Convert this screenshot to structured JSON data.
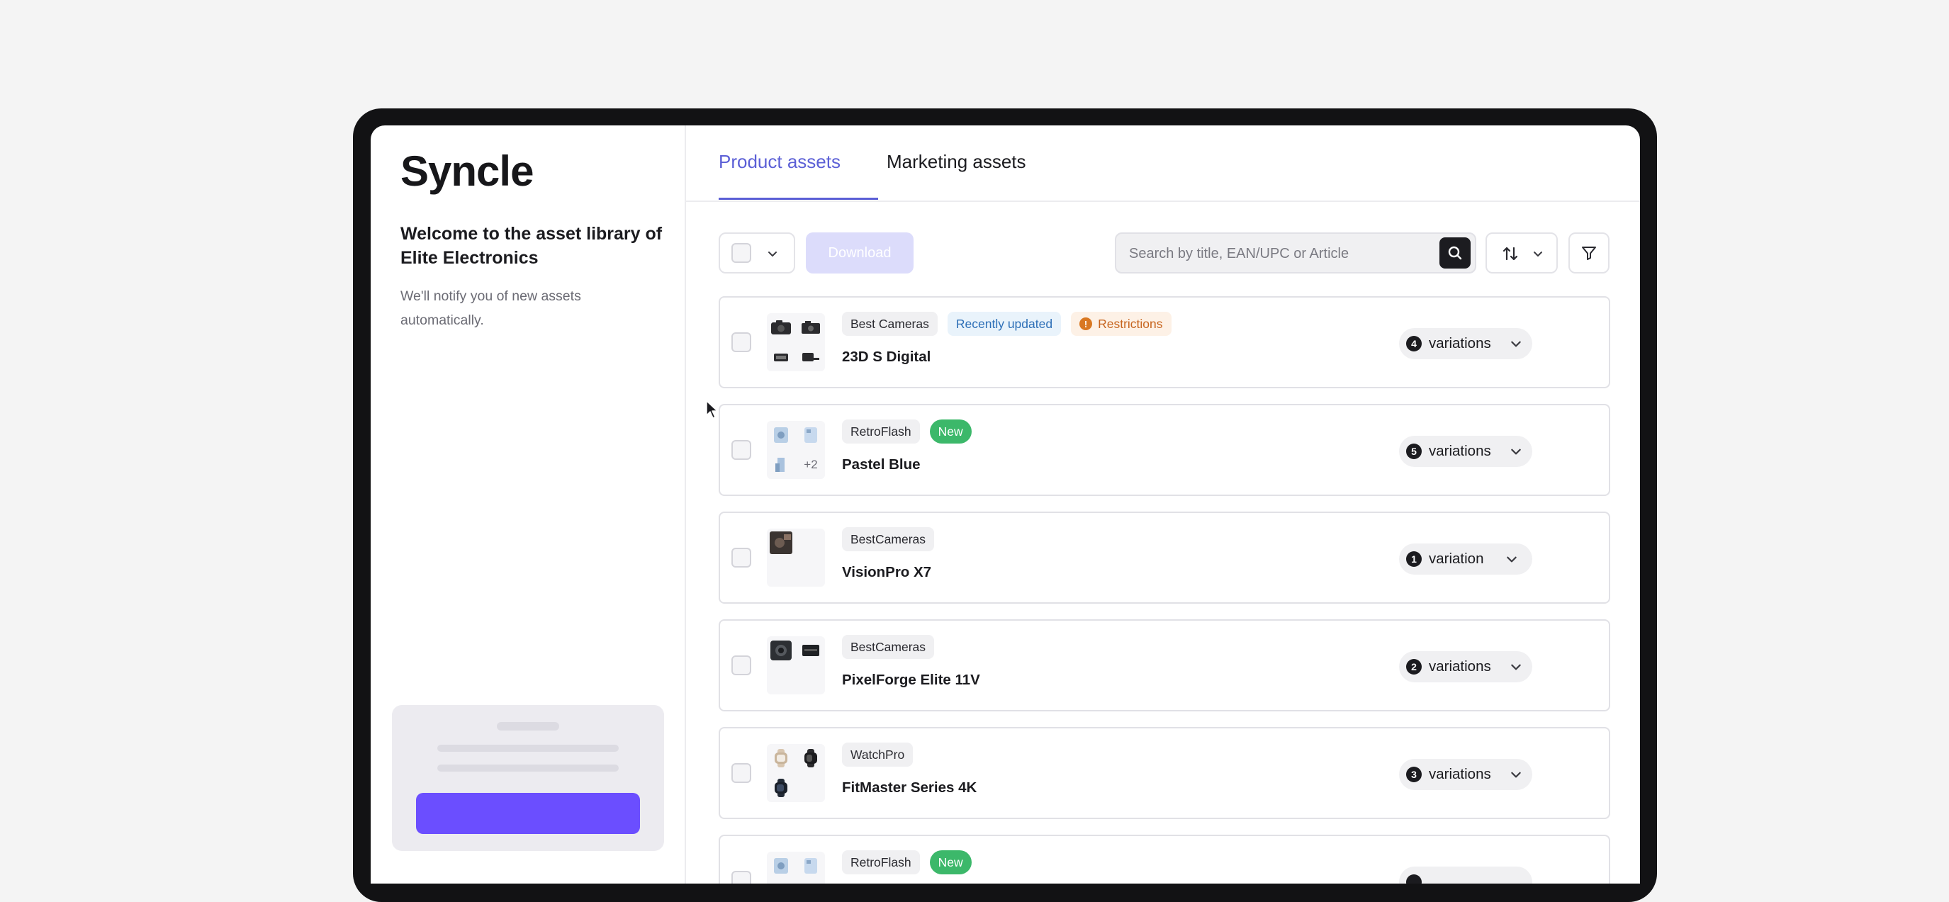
{
  "app": {
    "logo": "Syncle"
  },
  "sidebar": {
    "welcome": "Welcome to the asset library of Elite Electronics",
    "notify": "We'll notify you of new assets automatically."
  },
  "tabs": [
    {
      "label": "Product assets",
      "active": true
    },
    {
      "label": "Marketing assets",
      "active": false
    }
  ],
  "toolbar": {
    "download_label": "Download",
    "search_placeholder": "Search by title, EAN/UPC or Article"
  },
  "colors": {
    "accent": "#5b5fd6",
    "new_badge": "#3cb86a",
    "restriction": "#c7651f",
    "updated": "#2d6fb7"
  },
  "products": [
    {
      "name": "23D S Digital",
      "brand": "Best Cameras",
      "recently_updated": "Recently updated",
      "restrictions": "Restrictions",
      "variation_count": "4",
      "variation_label": "variations"
    },
    {
      "name": "Pastel Blue",
      "brand": "RetroFlash",
      "new_label": "New",
      "thumb_more": "+2",
      "variation_count": "5",
      "variation_label": "variations"
    },
    {
      "name": "VisionPro X7",
      "brand": "BestCameras",
      "variation_count": "1",
      "variation_label": "variation"
    },
    {
      "name": "PixelForge Elite 11V",
      "brand": "BestCameras",
      "variation_count": "2",
      "variation_label": "variations"
    },
    {
      "name": "FitMaster Series 4K",
      "brand": "WatchPro",
      "variation_count": "3",
      "variation_label": "variations"
    },
    {
      "brand": "RetroFlash",
      "new_label": "New"
    }
  ]
}
